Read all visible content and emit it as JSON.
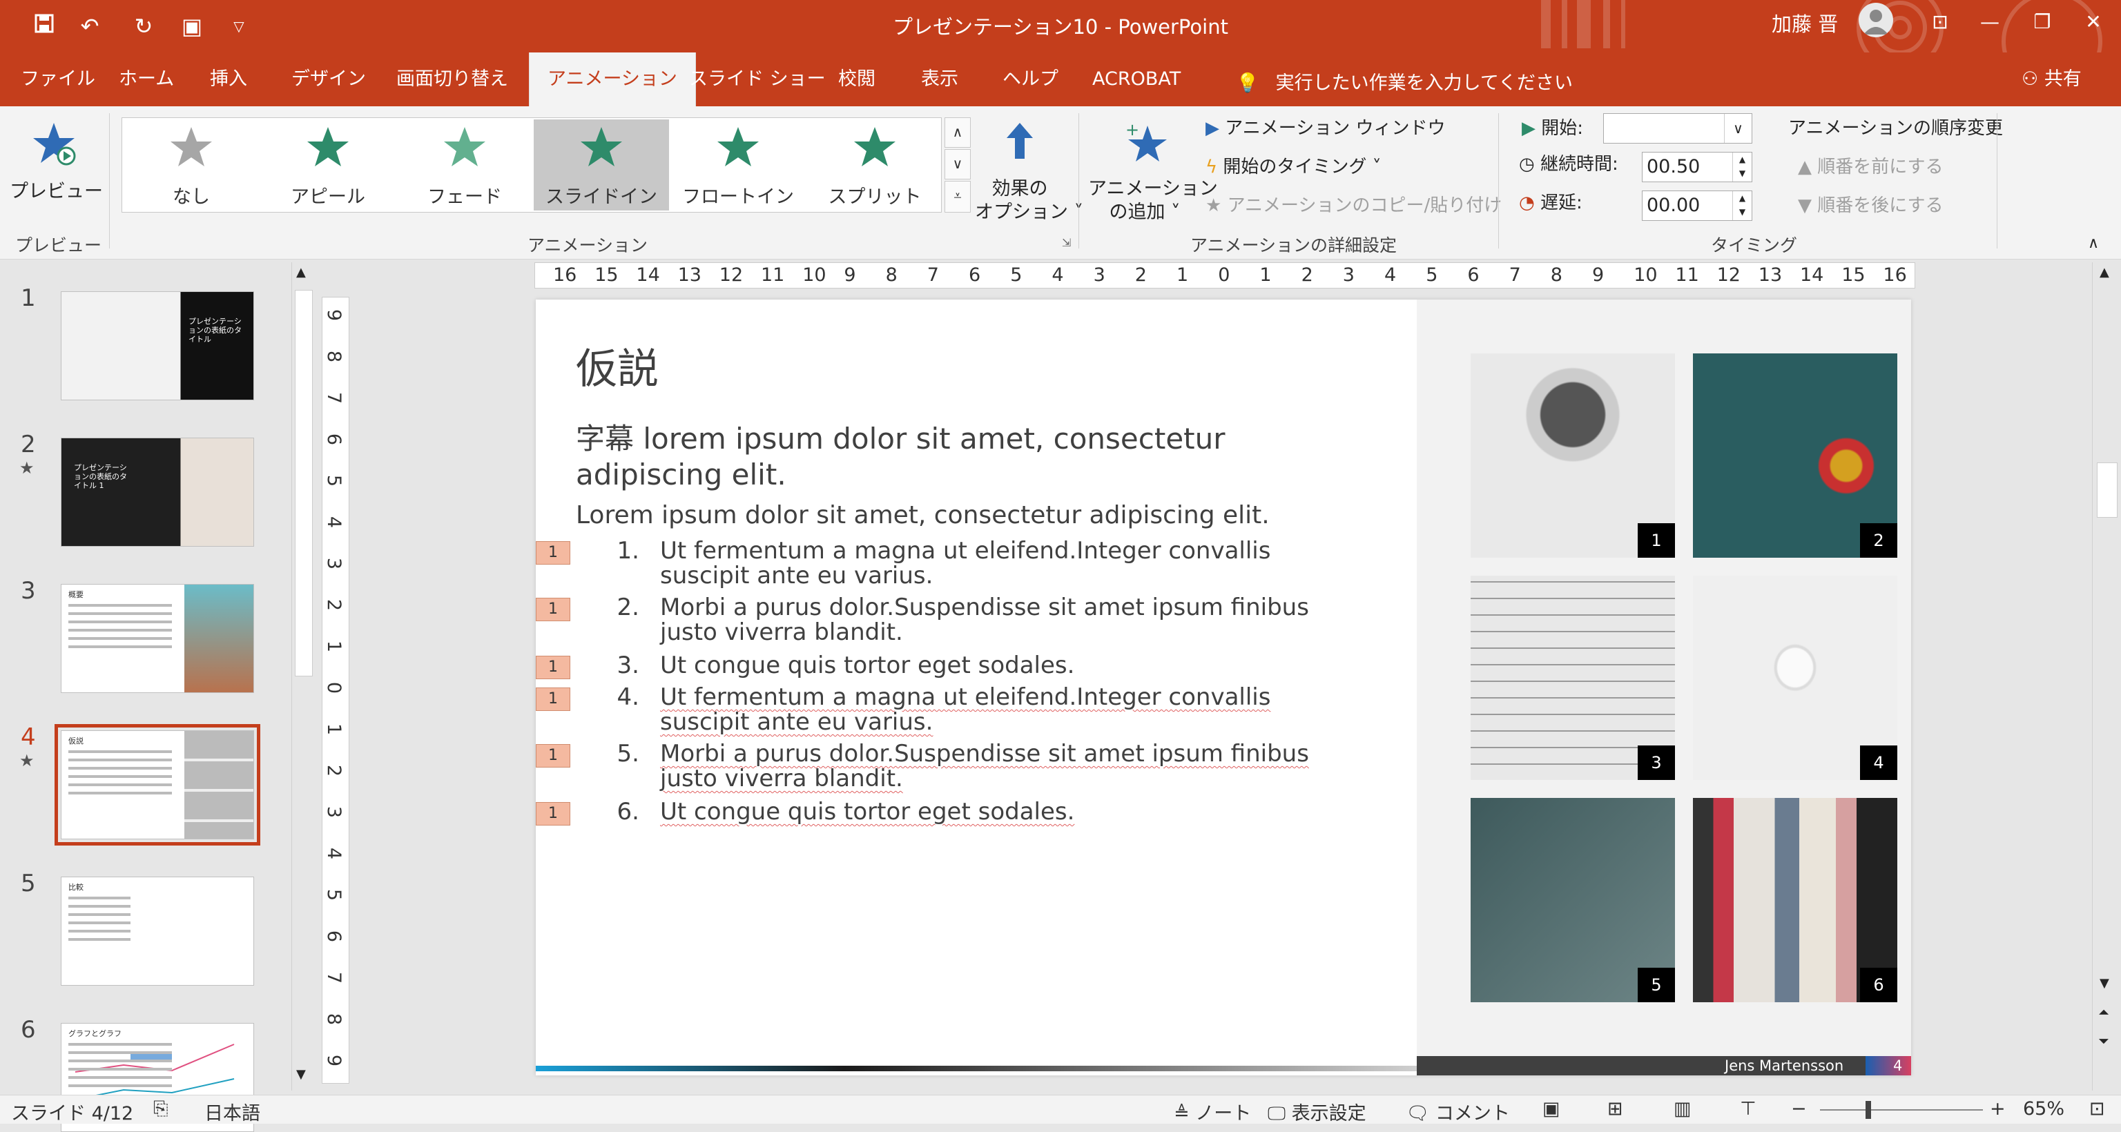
{
  "app": {
    "title": "プレゼンテーション10  -  PowerPoint",
    "user": "加藤 晋",
    "accent": "#c43e1c"
  },
  "quick_access": [
    "save-icon",
    "undo-icon",
    "redo-icon",
    "present-icon",
    "customize-icon"
  ],
  "tabs": [
    {
      "label": "ファイル"
    },
    {
      "label": "ホーム"
    },
    {
      "label": "挿入"
    },
    {
      "label": "デザイン"
    },
    {
      "label": "画面切り替え"
    },
    {
      "label": "アニメーション",
      "active": true
    },
    {
      "label": "スライド ショー"
    },
    {
      "label": "校閲"
    },
    {
      "label": "表示"
    },
    {
      "label": "ヘルプ"
    },
    {
      "label": "ACROBAT"
    }
  ],
  "tell_me": "実行したい作業を入力してください",
  "share": "共有",
  "ribbon": {
    "preview_button": "プレビュー",
    "preview_group": "プレビュー",
    "gallery": [
      {
        "label": "なし",
        "color": "#a6a6a6"
      },
      {
        "label": "アピール",
        "color": "#2e8b6a"
      },
      {
        "label": "フェード",
        "color": "#62b08f"
      },
      {
        "label": "スライドイン",
        "color": "#2e8b6a",
        "selected": true
      },
      {
        "label": "フロートイン",
        "color": "#2e8b6a"
      },
      {
        "label": "スプリット",
        "color": "#2e8b6a"
      }
    ],
    "effect_options_1": "効果の",
    "effect_options_2": "オプション ˅",
    "animation_group": "アニメーション",
    "add_animation_1": "アニメーション",
    "add_animation_2": "の追加 ˅",
    "animation_window": "アニメーション ウィンドウ",
    "trigger": "開始のタイミング ˅",
    "anim_painter": "アニメーションのコピー/貼り付け",
    "advanced_group": "アニメーションの詳細設定",
    "start_label": "開始:",
    "start_value": "",
    "duration_label": "継続時間:",
    "duration_value": "00.50",
    "delay_label": "遅延:",
    "delay_value": "00.00",
    "reorder_title": "アニメーションの順序変更",
    "move_earlier": "順番を前にする",
    "move_later": "順番を後にする",
    "timing_group": "タイミング"
  },
  "thumbnails": [
    {
      "num": "1",
      "star": false,
      "title": "プレゼンテーションの表紙のタイトル"
    },
    {
      "num": "2",
      "star": true,
      "title": "プレゼンテーションの表紙のタイトル 1"
    },
    {
      "num": "3",
      "star": false,
      "title": "概要"
    },
    {
      "num": "4",
      "star": true,
      "title": "仮説",
      "current": true
    },
    {
      "num": "5",
      "star": false,
      "title": "比較"
    },
    {
      "num": "6",
      "star": false,
      "title": "グラフとグラフ"
    }
  ],
  "hruler": [
    "16",
    "15",
    "14",
    "13",
    "12",
    "11",
    "10",
    "9",
    "8",
    "7",
    "6",
    "5",
    "4",
    "3",
    "2",
    "1",
    "0",
    "1",
    "2",
    "3",
    "4",
    "5",
    "6",
    "7",
    "8",
    "9",
    "10",
    "11",
    "12",
    "13",
    "14",
    "15",
    "16"
  ],
  "vruler": [
    "9",
    "8",
    "7",
    "6",
    "5",
    "4",
    "3",
    "2",
    "1",
    "0",
    "1",
    "2",
    "3",
    "4",
    "5",
    "6",
    "7",
    "8",
    "9"
  ],
  "slide": {
    "title": "仮説",
    "subtitle": "字幕 lorem ipsum dolor sit amet, consectetur adipiscing elit.",
    "intro": "Lorem ipsum dolor sit amet, consectetur adipiscing elit.",
    "items": [
      {
        "num": "1.",
        "text": "Ut fermentum a magna ut eleifend.Integer convallis suscipit ante eu varius.",
        "tag": "1"
      },
      {
        "num": "2.",
        "text": "Morbi a purus dolor.Suspendisse sit amet ipsum finibus justo viverra blandit.",
        "tag": "1"
      },
      {
        "num": "3.",
        "text": "Ut congue quis tortor eget sodales.",
        "tag": "1"
      },
      {
        "num": "4.",
        "text": "Ut fermentum a magna ut eleifend.Integer convallis suscipit ante eu varius.",
        "tag": "1"
      },
      {
        "num": "5.",
        "text": "Morbi a purus dolor.Suspendisse sit amet ipsum finibus justo viverra blandit.",
        "tag": "1"
      },
      {
        "num": "6.",
        "text": "Ut congue quis tortor eget sodales.",
        "tag": "1"
      }
    ],
    "photos": [
      {
        "badge": "1",
        "name": "microscope-photo"
      },
      {
        "badge": "2",
        "name": "pencils-chalkboard-photo"
      },
      {
        "badge": "3",
        "name": "blueprint-photo"
      },
      {
        "badge": "4",
        "name": "astronaut-photo"
      },
      {
        "badge": "5",
        "name": "chalkboard-formula-photo"
      },
      {
        "badge": "6",
        "name": "books-photo"
      }
    ],
    "footer_author": "Jens Martensson",
    "footer_page": "4"
  },
  "status": {
    "slide_info": "スライド 4/12",
    "language": "日本語",
    "notes": "ノート",
    "display_settings": "表示設定",
    "comments": "コメント",
    "zoom": "65%"
  }
}
